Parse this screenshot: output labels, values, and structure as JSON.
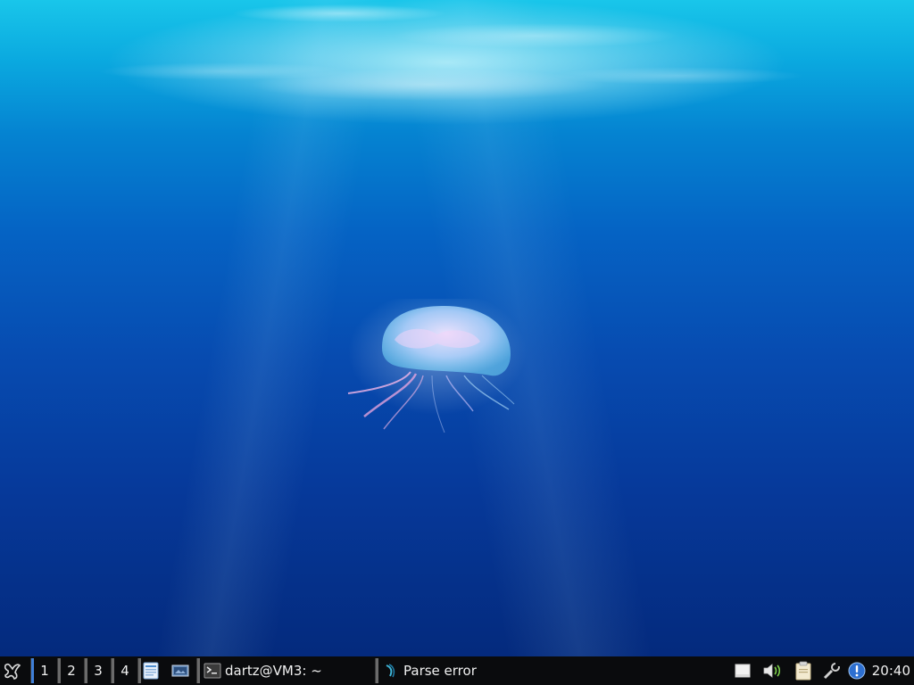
{
  "desktop": {
    "wallpaper": "underwater jellyfish"
  },
  "taskbar": {
    "menu_icon": "menu-logo-icon",
    "desktops": [
      "1",
      "2",
      "3",
      "4"
    ],
    "active_desktop": "1",
    "launchers": [
      {
        "name": "file-manager-icon"
      },
      {
        "name": "show-desktop-icon"
      }
    ],
    "tasks": [
      {
        "label": "dartz@VM3: ~",
        "icon": "terminal-icon"
      },
      {
        "label": "Parse error",
        "icon": "kdialog-icon"
      }
    ],
    "tray": [
      {
        "name": "removable-drive-icon"
      },
      {
        "name": "volume-icon"
      },
      {
        "name": "clipboard-icon"
      },
      {
        "name": "network-tools-icon"
      },
      {
        "name": "notification-icon"
      }
    ],
    "clock": "20:40"
  },
  "colors": {
    "taskbar_bg": "#0a0b0d",
    "active_desktop_accent": "#3f7fd8",
    "water_top": "#19c6ea",
    "water_bottom": "#042a7d"
  }
}
